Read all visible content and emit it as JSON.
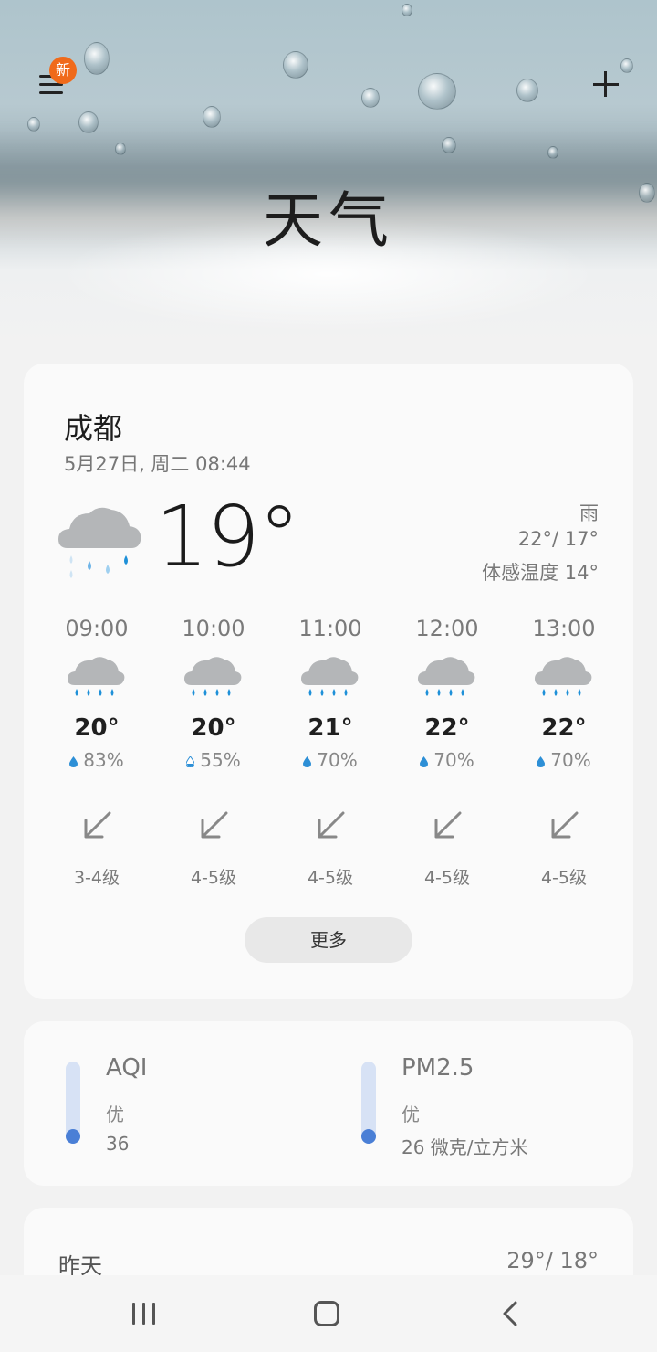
{
  "header": {
    "title": "天气",
    "menu_badge": "新"
  },
  "current": {
    "city": "成都",
    "datetime": "5月27日, 周二 08:44",
    "temperature": "19°",
    "condition": "雨",
    "high_low": "22°/ 17°",
    "feels_like": "体感温度 14°",
    "icon": "rain-cloud-icon"
  },
  "hourly": [
    {
      "time": "09:00",
      "temp": "20°",
      "humidity": "83%",
      "wind": "3-4级",
      "icon": "rain-cloud-icon"
    },
    {
      "time": "10:00",
      "temp": "20°",
      "humidity": "55%",
      "wind": "4-5级",
      "icon": "rain-cloud-icon"
    },
    {
      "time": "11:00",
      "temp": "21°",
      "humidity": "70%",
      "wind": "4-5级",
      "icon": "rain-cloud-icon"
    },
    {
      "time": "12:00",
      "temp": "22°",
      "humidity": "70%",
      "wind": "4-5级",
      "icon": "rain-cloud-icon"
    },
    {
      "time": "13:00",
      "temp": "22°",
      "humidity": "70%",
      "wind": "4-5级",
      "icon": "rain-cloud-icon"
    }
  ],
  "more_label": "更多",
  "air": [
    {
      "label": "AQI",
      "level": "优",
      "value": "36"
    },
    {
      "label": "PM2.5",
      "level": "优",
      "value": "26 微克/立方米"
    }
  ],
  "yesterday": {
    "label": "昨天",
    "high_low": "29°/ 18°"
  },
  "colors": {
    "accent_badge": "#f06a1a",
    "rain_drop": "#1e90d8",
    "aqi_dot": "#4a7fd6"
  }
}
